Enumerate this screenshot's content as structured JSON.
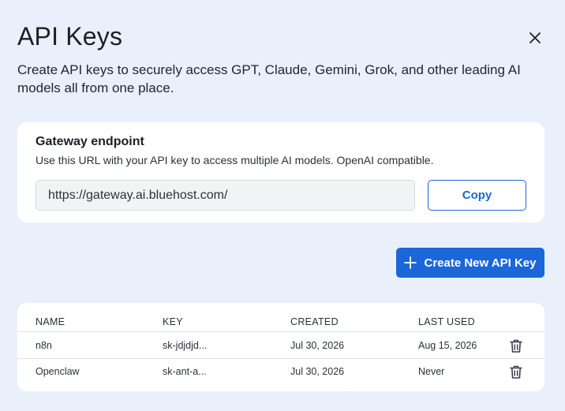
{
  "header": {
    "title": "API Keys",
    "subtitle": "Create API keys to securely access GPT, Claude, Gemini, Grok, and other leading AI models all from one place.",
    "close_icon": "close-icon"
  },
  "gateway": {
    "title": "Gateway endpoint",
    "description": "Use this URL with your API key to access multiple AI models. OpenAI compatible.",
    "url": "https://gateway.ai.bluehost.com/",
    "copy_label": "Copy"
  },
  "actions": {
    "create_label": "Create New API Key",
    "create_icon": "plus-icon"
  },
  "table": {
    "columns": [
      "NAME",
      "KEY",
      "CREATED",
      "LAST USED"
    ],
    "rows": [
      {
        "name": "n8n",
        "key": "sk-jdjdjd...",
        "created": "Jul 30, 2026",
        "last_used": "Aug 15, 2026"
      },
      {
        "name": "Openclaw",
        "key": "sk-ant-a...",
        "created": "Jul 30, 2026",
        "last_used": "Never"
      }
    ],
    "delete_icon": "trash-icon"
  },
  "colors": {
    "background": "#eaf0fb",
    "card": "#ffffff",
    "accent": "#1b66d8",
    "text": "#1f2430"
  }
}
